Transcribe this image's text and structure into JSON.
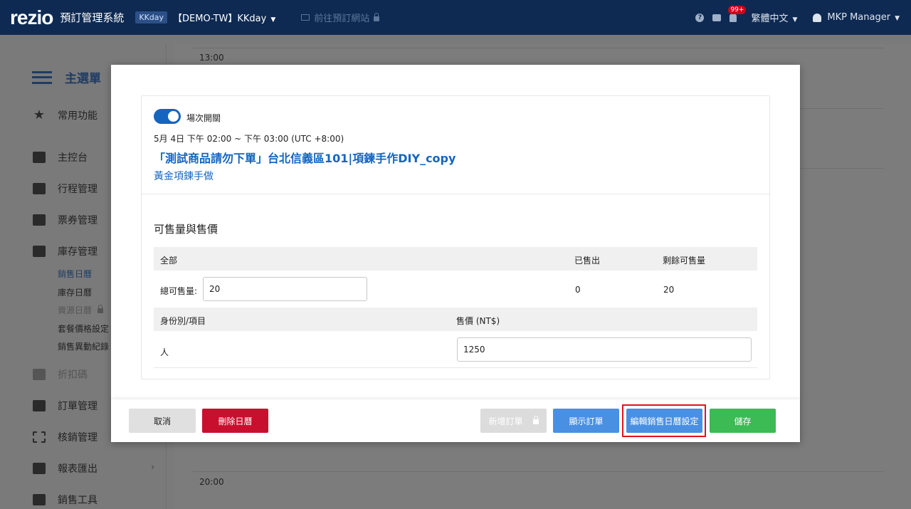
{
  "topbar": {
    "logo": "rezio",
    "system_title": "預訂管理系統",
    "channel_tag": "KKday",
    "store": "【DEMO-TW】KKday",
    "visit_site": "前往預訂網站",
    "notification_count": "99+",
    "language": "繁體中文",
    "user": "MKP Manager"
  },
  "sidebar": {
    "title": "主選單",
    "items": {
      "favorites": "常用功能",
      "dashboard": "主控台",
      "itinerary": "行程管理",
      "tickets": "票券管理",
      "inventory": "庫存管理",
      "discount": "折扣碼",
      "orders": "訂單管理",
      "redemption": "核銷管理",
      "reports": "報表匯出",
      "sales_tools": "銷售工具"
    },
    "sub_items": {
      "sales_calendar": "銷售日曆",
      "inventory_calendar": "庫存日曆",
      "resource_calendar": "資源日曆",
      "package_pricing": "套餐價格設定",
      "sales_log": "銷售異動紀錄"
    }
  },
  "calendar": {
    "times": [
      "13:00",
      "20:00"
    ]
  },
  "modal": {
    "toggle_label": "場次開關",
    "session_time": "5月 4日 下午 02:00 ~ 下午 03:00 (UTC +8:00)",
    "product_title": "「測試商品請勿下單」台北信義區101|項鍊手作DIY_copy",
    "product_subtitle": "黃金項鍊手做",
    "section_title": "可售量與售價",
    "inventory_table": {
      "col_all": "全部",
      "col_sold": "已售出",
      "col_remaining": "剩餘可售量",
      "total_label": "總可售量:",
      "total_value": "20",
      "sold_value": "0",
      "remaining_value": "20"
    },
    "price_table": {
      "col_identity": "身份別/項目",
      "col_price": "售價 (NT$)",
      "rows": [
        {
          "identity": "人",
          "price": "1250"
        }
      ]
    },
    "buttons": {
      "cancel": "取消",
      "delete_calendar": "刪除日曆",
      "add_order": "新增訂單",
      "show_orders": "顯示訂單",
      "edit_calendar_settings": "編輯銷售日曆設定",
      "save": "儲存"
    }
  },
  "colors": {
    "topbar_bg": "#0e2a52",
    "accent_blue": "#1565c0",
    "button_blue": "#4a90e2",
    "delete_red": "#c8102e",
    "save_green": "#3cba54",
    "highlight_outline": "#e0131f"
  }
}
